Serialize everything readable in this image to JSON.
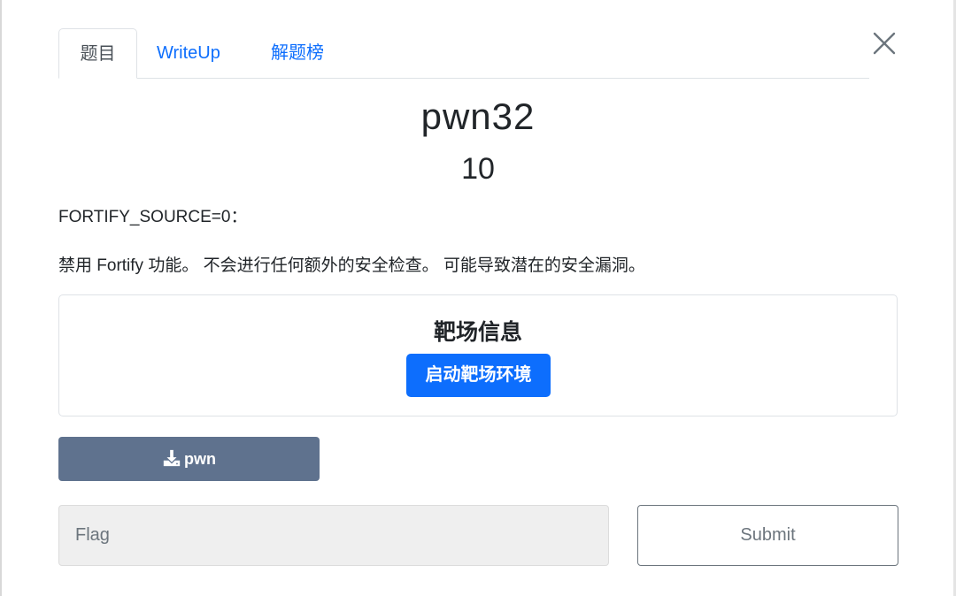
{
  "tabs": [
    {
      "label": "题目",
      "active": true
    },
    {
      "label": "WriteUp",
      "active": false
    },
    {
      "label": "解题榜",
      "active": false
    }
  ],
  "challenge": {
    "name": "pwn32",
    "points": "10",
    "description": [
      "FORTIFY_SOURCE=0：",
      "禁用 Fortify 功能。 不会进行任何额外的安全检查。 可能导致潜在的安全漏洞。"
    ]
  },
  "target": {
    "title": "靶场信息",
    "start_button": "启动靶场环境"
  },
  "download": {
    "icon": "download-icon",
    "label": "pwn"
  },
  "flag_form": {
    "placeholder": "Flag",
    "value": "",
    "submit_label": "Submit"
  },
  "icons": {
    "close": "close-icon"
  },
  "colors": {
    "primary": "#0d6efd",
    "download_button": "#5f728e",
    "input_bg": "#efefef",
    "text": "#212529"
  }
}
